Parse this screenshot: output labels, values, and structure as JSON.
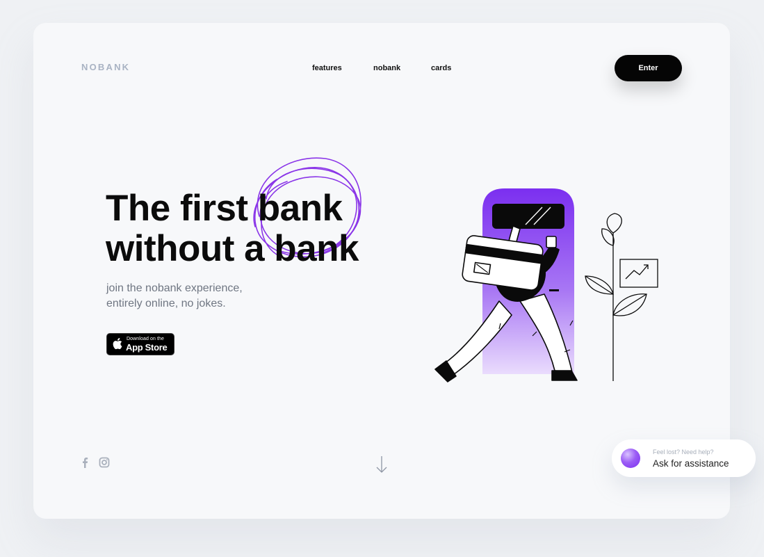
{
  "brand": {
    "logo": "NOBANK"
  },
  "nav": {
    "items": [
      {
        "label": "features"
      },
      {
        "label": "nobank"
      },
      {
        "label": "cards"
      }
    ],
    "enter_label": "Enter"
  },
  "hero": {
    "headline_line1": "The first bank",
    "headline_line2": "without a bank",
    "subtitle_line1": "join the nobank experience,",
    "subtitle_line2": "entirely online, no jokes.",
    "appstore": {
      "small": "Download on the",
      "big": "App Store"
    }
  },
  "social": {
    "icons": [
      "facebook-icon",
      "instagram-icon"
    ]
  },
  "assistance": {
    "question": "Feel lost? Need help?",
    "action": "Ask for assistance"
  },
  "colors": {
    "accent": "#7b2ff0",
    "button": "#050505",
    "page_bg": "#eff1f4",
    "card_bg": "#f7f8fa"
  }
}
